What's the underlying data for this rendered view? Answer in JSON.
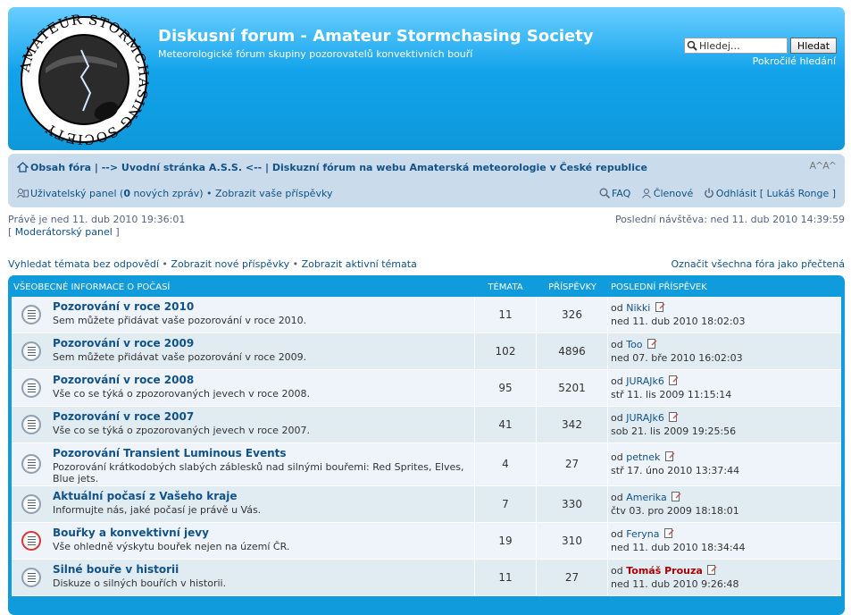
{
  "header": {
    "title": "Diskusní forum - Amateur Stormchasing Society",
    "description": "Meteorologické fórum skupiny pozorovatelů konvektivních bouří",
    "logo_text": "AMATEUR STORMCHASING SOCIETY",
    "search_placeholder": "Hledej…",
    "search_button": "Hledat",
    "advanced_search": "Pokročilé hledání"
  },
  "navbar": {
    "breadcrumbs": [
      "Obsah fóra",
      "--> Uvodní stránka A.S.S. <--",
      "Diskuzní fórum na webu Amaterská meteorologie v České republice"
    ],
    "breadcrumb_sep": " | ",
    "font_resize": "A^A^",
    "user_panel": "Uživatelský panel",
    "new_messages_prefix": " (",
    "new_messages_count": "0",
    "new_messages_suffix": " nových zpráv)",
    "bullet": " • ",
    "show_posts": "Zobrazit vaše příspěvky",
    "faq": "FAQ",
    "members": "Členové",
    "logout": "Odhlásit [ Lukáš Ronge ]"
  },
  "info": {
    "current_time": "Právě je ned 11. dub 2010 19:36:01",
    "mod_panel_open": "[ ",
    "mod_panel": "Moderátorský panel",
    "mod_panel_close": " ]",
    "last_visit": "Poslední návštěva: ned 11. dub 2010 14:39:59",
    "links": [
      "Vyhledat témata bez odpovědí",
      "Zobrazit nové příspěvky",
      "Zobrazit aktivní témata"
    ],
    "mark_read": "Označit všechna fóra jako přečtená"
  },
  "forum_table": {
    "category": "Všeobecné informace o počasí",
    "col_topics": "Témata",
    "col_posts": "Příspěvky",
    "col_last": "Poslední příspěvek",
    "rows": [
      {
        "title": "Pozorování v roce 2010",
        "desc": "Sem můžete přidávat vaše pozorování v roce 2010.",
        "topics": "11",
        "posts": "326",
        "by": "od ",
        "author": "Nikki",
        "date": "ned 11. dub 2010 18:02:03"
      },
      {
        "title": "Pozorování v roce 2009",
        "desc": "Sem můžete přidávat vaše pozorování v roce 2009.",
        "topics": "102",
        "posts": "4896",
        "by": "od ",
        "author": "Too",
        "date": "ned 07. bře 2010 16:02:03"
      },
      {
        "title": "Pozorování v roce 2008",
        "desc": "Vše co se týká o zpozorovaných jevech v roce 2008.",
        "topics": "95",
        "posts": "5201",
        "by": "od ",
        "author": "JURAJk6",
        "date": "stř 11. lis 2009 11:15:14"
      },
      {
        "title": "Pozorování v roce 2007",
        "desc": "Vše co se týká o zpozorovaných jevech v roce 2007.",
        "topics": "41",
        "posts": "342",
        "by": "od ",
        "author": "JURAJk6",
        "date": "sob 21. lis 2009 19:25:56"
      },
      {
        "title": "Pozorování Transient Luminous Events",
        "desc": "Pozorování krátkodobých slabých záblesků nad silnými bouřemi: Red Sprites, Elves, Blue jets.",
        "topics": "4",
        "posts": "27",
        "by": "od ",
        "author": "petnek",
        "date": "stř 17. úno 2010 13:37:44"
      },
      {
        "title": "Aktuální počasí z Vašeho kraje",
        "desc": "Informujte nás, jaké počasí je právě u Vás.",
        "topics": "7",
        "posts": "330",
        "by": "od ",
        "author": "Amerika",
        "date": "čtv 03. pro 2009 18:18:01"
      },
      {
        "title": "Bouřky a konvektivní jevy",
        "desc": "Vše ohledně výskytu bouřek nejen na území ČR.",
        "topics": "19",
        "posts": "310",
        "by": "od ",
        "author": "Feryna",
        "date": "ned 11. dub 2010 18:34:44"
      },
      {
        "title": "Silné bouře v historii",
        "desc": "Diskuze o silných bouřích v historii.",
        "topics": "11",
        "posts": "27",
        "by": "od ",
        "author": "Tomáš Prouza",
        "date": "ned 11. dub 2010 9:26:48"
      }
    ]
  },
  "colors": {
    "header_blue": "#12a3eb",
    "navbar_bg": "#cadceb",
    "link": "#105289",
    "unread_icon": "#d23a3a",
    "moderator_name": "#aa0000"
  }
}
